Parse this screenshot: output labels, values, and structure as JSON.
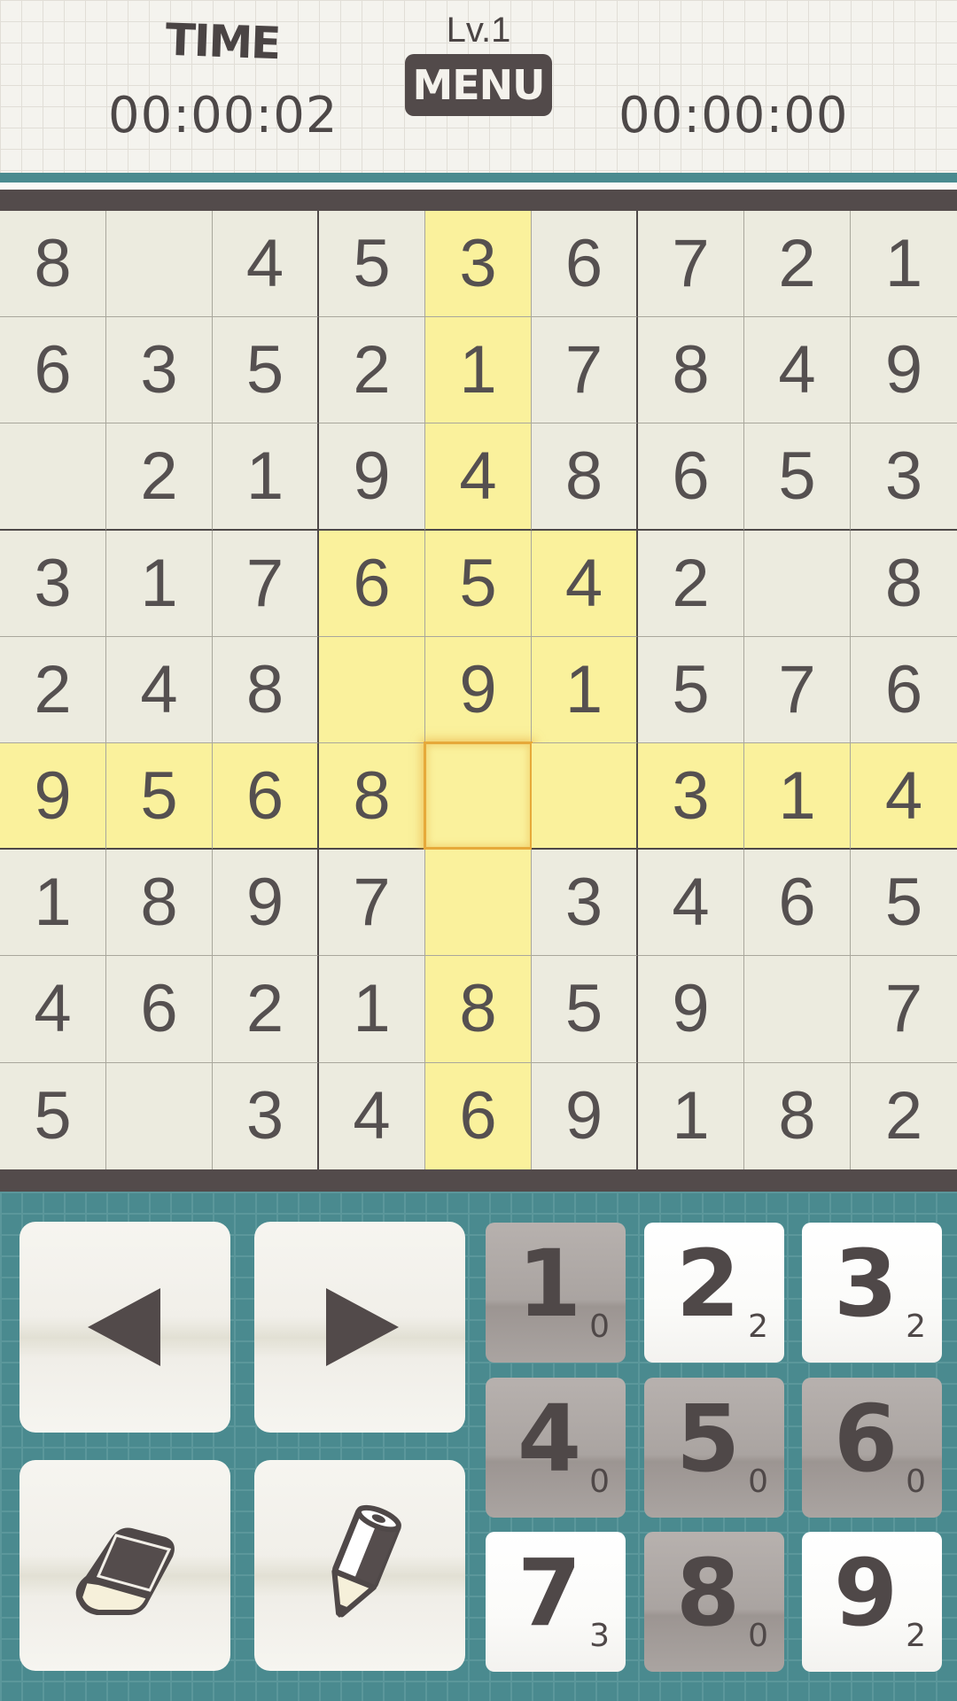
{
  "header": {
    "time_label": "TIME",
    "elapsed_time": "00:00:02",
    "level": "Lv.1",
    "menu_label": "MENU",
    "best_time": "00:00:00"
  },
  "board": {
    "rows": [
      [
        "8",
        "",
        "4",
        "5",
        "3",
        "6",
        "7",
        "2",
        "1"
      ],
      [
        "6",
        "3",
        "5",
        "2",
        "1",
        "7",
        "8",
        "4",
        "9"
      ],
      [
        "",
        "2",
        "1",
        "9",
        "4",
        "8",
        "6",
        "5",
        "3"
      ],
      [
        "3",
        "1",
        "7",
        "6",
        "5",
        "4",
        "2",
        "",
        "8"
      ],
      [
        "2",
        "4",
        "8",
        "",
        "9",
        "1",
        "5",
        "7",
        "6"
      ],
      [
        "9",
        "5",
        "6",
        "8",
        "",
        "",
        "3",
        "1",
        "4"
      ],
      [
        "1",
        "8",
        "9",
        "7",
        "",
        "3",
        "4",
        "6",
        "5"
      ],
      [
        "4",
        "6",
        "2",
        "1",
        "8",
        "5",
        "9",
        "",
        "7"
      ],
      [
        "5",
        "",
        "3",
        "4",
        "6",
        "9",
        "1",
        "8",
        "2"
      ]
    ],
    "selected": {
      "row": 5,
      "col": 4
    },
    "highlight_color": "#faf19c"
  },
  "controls": {
    "prev": "left-arrow-icon",
    "next": "right-arrow-icon",
    "erase": "eraser-icon",
    "memo": "pencil-icon"
  },
  "numpad": [
    {
      "digit": "1",
      "remaining": "0",
      "used": true
    },
    {
      "digit": "2",
      "remaining": "2",
      "used": false
    },
    {
      "digit": "3",
      "remaining": "2",
      "used": false
    },
    {
      "digit": "4",
      "remaining": "0",
      "used": true
    },
    {
      "digit": "5",
      "remaining": "0",
      "used": true
    },
    {
      "digit": "6",
      "remaining": "0",
      "used": true
    },
    {
      "digit": "7",
      "remaining": "3",
      "used": false
    },
    {
      "digit": "8",
      "remaining": "0",
      "used": true
    },
    {
      "digit": "9",
      "remaining": "2",
      "used": false
    }
  ]
}
